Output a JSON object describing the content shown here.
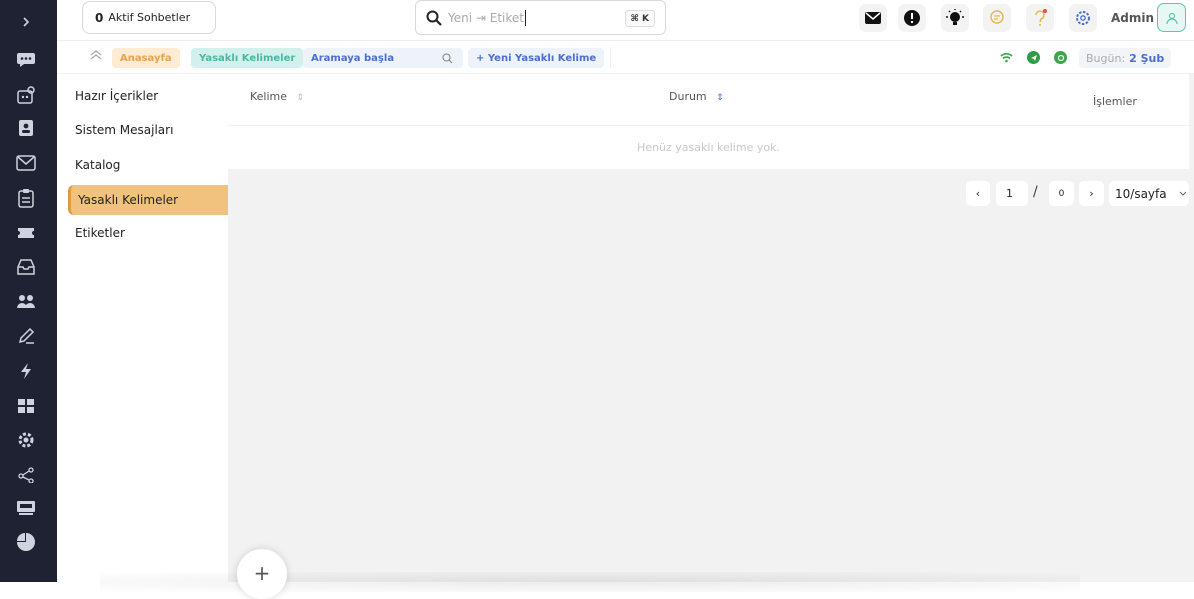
{
  "header": {
    "active_chats_count": "0",
    "active_chats_label": "Aktif Sohbetler",
    "search_placeholder": "Yeni ⇥ Etiket",
    "search_shortcut": "⌘ K",
    "user_name": "Admin"
  },
  "breadcrumb": {
    "home": "Anasayfa",
    "current": "Yasaklı Kelimeler",
    "search_placeholder": "Aramaya başla",
    "new_button": "+ Yeni Yasaklı Kelime",
    "date_label": "Bugün:",
    "date_value": "2 Şub"
  },
  "submenu": {
    "items": [
      {
        "label": "Hazır İçerikler"
      },
      {
        "label": "Sistem Mesajları"
      },
      {
        "label": "Katalog"
      },
      {
        "label": "Yasaklı Kelimeler"
      },
      {
        "label": "Etiketler"
      }
    ]
  },
  "table": {
    "columns": {
      "word": "Kelime",
      "status": "Durum",
      "actions": "İşlemler"
    },
    "empty_text": "Henüz yasaklı kelime yok."
  },
  "pagination": {
    "prev": "‹",
    "current_page": "1",
    "separator": "/",
    "total_pages": "0",
    "next": "›",
    "page_size": "10/sayfa"
  },
  "fab_label": "+",
  "colors": {
    "rail": "#1f2233",
    "accent_orange": "#f0c27e",
    "accent_teal": "#4bb6a4",
    "accent_blue": "#4a6fd0"
  }
}
